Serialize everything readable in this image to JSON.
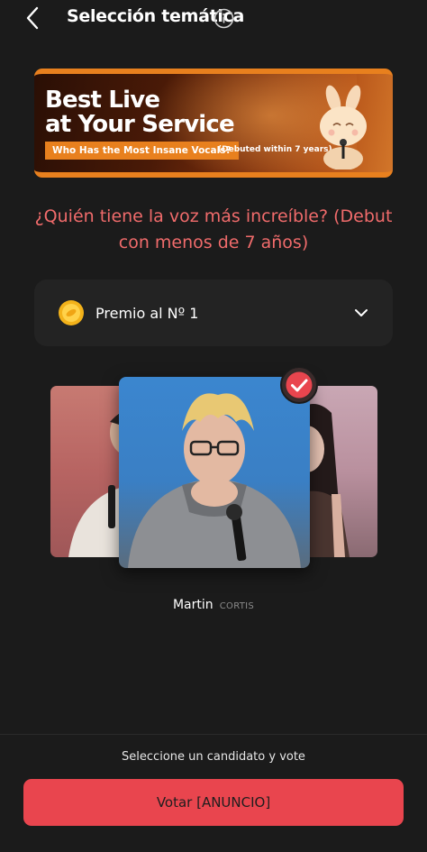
{
  "header": {
    "title": "Selección temática"
  },
  "banner": {
    "headline_line1": "Best Live",
    "headline_line2": "at Your Service",
    "subtitle": "Who Has the Most Insane Vocals?",
    "note": "(Debuted within 7 years)"
  },
  "question": "¿Quién tiene la voz más increíble? (Debut con menos de 7 años)",
  "prize": {
    "label": "Premio al Nº 1"
  },
  "candidate": {
    "name": "Martin",
    "group": "CORTIS",
    "selected": true
  },
  "footer": {
    "hint": "Seleccione un candidato y vote",
    "vote_label": "Votar [ANUNCIO]"
  },
  "colors": {
    "background": "#1b1b1b",
    "accent_red": "#e9454e",
    "question_text": "#f06b6b",
    "banner_orange": "#e8801e"
  },
  "icons": {
    "back": "chevron-left-icon",
    "info": "info-icon",
    "coin": "coin-icon",
    "dropdown": "chevron-down-icon",
    "selected": "check-icon"
  }
}
